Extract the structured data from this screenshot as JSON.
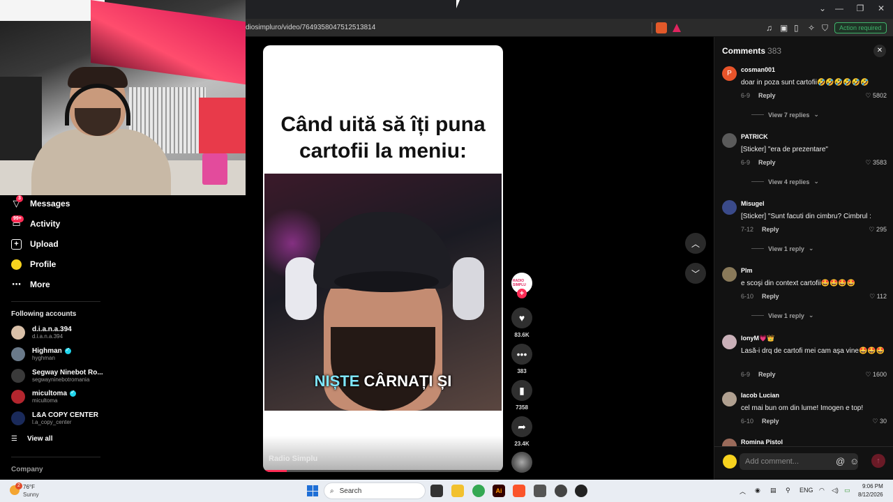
{
  "browser": {
    "url": "diosimpluro/video/7649358047512513814",
    "action_required": "Action required",
    "controls": [
      "⌄",
      "—",
      "❐",
      "✕"
    ]
  },
  "nav": {
    "messages": {
      "label": "Messages",
      "badge": "3"
    },
    "activity": {
      "label": "Activity",
      "badge": "99+"
    },
    "upload": {
      "label": "Upload"
    },
    "profile": {
      "label": "Profile"
    },
    "more": {
      "label": "More"
    }
  },
  "following": {
    "title": "Following accounts",
    "accounts": [
      {
        "name": "d.i.a.n.a.394",
        "handle": "d.i.a.n.a.394",
        "verified": false,
        "color": "#d9c0a8"
      },
      {
        "name": "Highman",
        "handle": "hyghman",
        "verified": true,
        "color": "#6a7a8a"
      },
      {
        "name": "Segway Ninebot Ro...",
        "handle": "segwayninebotromania",
        "verified": false,
        "color": "#3a3a3a"
      },
      {
        "name": "micultoma",
        "handle": "micultoma",
        "verified": true,
        "color": "#b3262e"
      },
      {
        "name": "L&A COPY CENTER",
        "handle": "l.a_copy_center",
        "verified": false,
        "color": "#1a2a5a"
      }
    ],
    "view_all": "View all"
  },
  "company": "Company",
  "video": {
    "caption": "Când uită să îți puna cartofii la meniu:",
    "subtitle_hl": "NIȘTE",
    "subtitle_rest": "CÂRNAȚI ȘI",
    "author": "Radio Simplu",
    "progress": 0.1
  },
  "actions": {
    "creator_label": "RADIO SIMPLU",
    "likes": "83.6K",
    "comments": "383",
    "saves": "7358",
    "shares": "23.4K"
  },
  "comments_panel": {
    "title": "Comments",
    "count": "383",
    "placeholder": "Add comment...",
    "items": [
      {
        "user": "cosman001",
        "text": "doar in poza sunt cartofii🤣🤣🤣🤣🤣🤣",
        "date": "6-9",
        "reply": "Reply",
        "likes": "5802",
        "replies": "View 7 replies",
        "avatar_color": "#e8542a",
        "avatar_letter": "P"
      },
      {
        "user": "PATRICK",
        "text": "[Sticker] \"era de prezentare\"",
        "date": "6-9",
        "reply": "Reply",
        "likes": "3583",
        "replies": "View 4 replies",
        "avatar_color": "#5a5a5a",
        "avatar_letter": ""
      },
      {
        "user": "Misugel",
        "text": "[Sticker] \"Sunt facuti din cimbru? Cimbrul :",
        "date": "7-12",
        "reply": "Reply",
        "likes": "295",
        "replies": "View 1 reply",
        "avatar_color": "#3a4a8a",
        "avatar_letter": ""
      },
      {
        "user": "Plm",
        "text": "e scoşi din context cartofii🤩🤩🤩🤩",
        "date": "6-10",
        "reply": "Reply",
        "likes": "112",
        "replies": "View 1 reply",
        "avatar_color": "#8a7a5a",
        "avatar_letter": ""
      },
      {
        "user": "lonyM💗👑",
        "text": "Lasă-i drq de cartofi mei cam aşa vine🤩🤩🤩",
        "date": "6-9",
        "reply": "Reply",
        "likes": "1600",
        "replies": "",
        "avatar_color": "#c9b0b8",
        "avatar_letter": ""
      },
      {
        "user": "Iacob Lucian",
        "text": "cel mai bun om din lume! Imogen e top!",
        "date": "6-10",
        "reply": "Reply",
        "likes": "30",
        "replies": "",
        "avatar_color": "#b0a090",
        "avatar_letter": ""
      },
      {
        "user": "Romina Pistol",
        "text": "",
        "date": "",
        "reply": "",
        "likes": "",
        "replies": "",
        "avatar_color": "#9a6a5a",
        "avatar_letter": ""
      }
    ]
  },
  "taskbar": {
    "weather_temp": "76°F",
    "weather_desc": "Sunny",
    "weather_badge": "2",
    "search": "Search",
    "lang": "ENG",
    "time": "9:06 PM",
    "date": "8/12/2026"
  }
}
